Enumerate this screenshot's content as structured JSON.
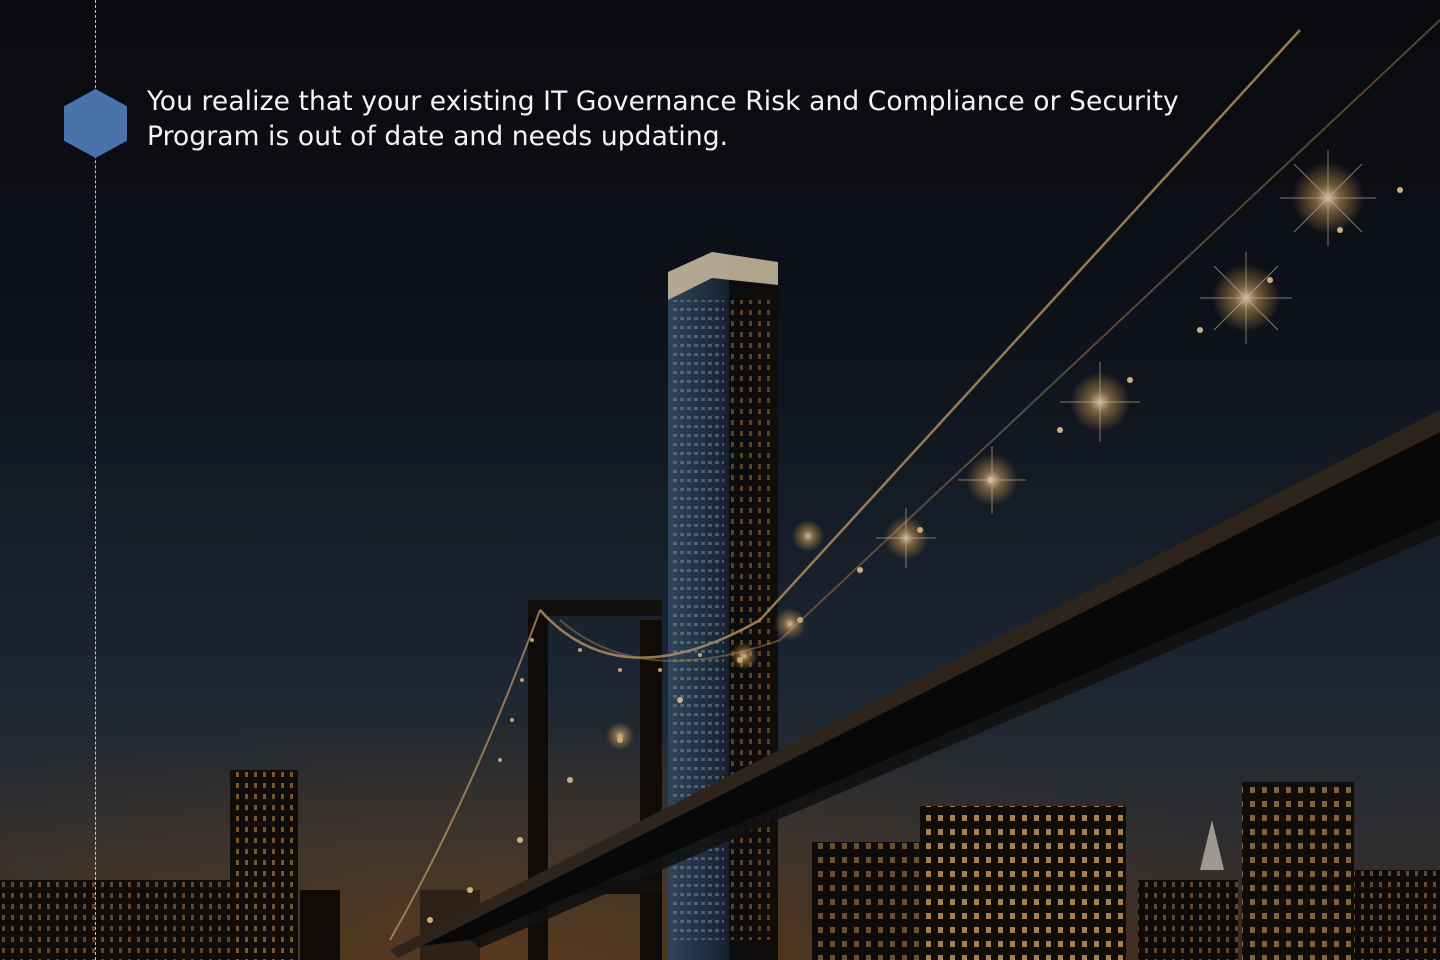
{
  "slide": {
    "text": "You realize that your existing IT Governance Risk and Compliance or Security Program is out of date and needs updating.",
    "marker_icon": "hexagon-icon",
    "marker_color": "#4a72ab"
  },
  "background": {
    "image": "night-city-bridge-photo",
    "sky_top": "#0c0d11",
    "sky_bottom": "#27384a",
    "light_color": "#ffd38a"
  }
}
